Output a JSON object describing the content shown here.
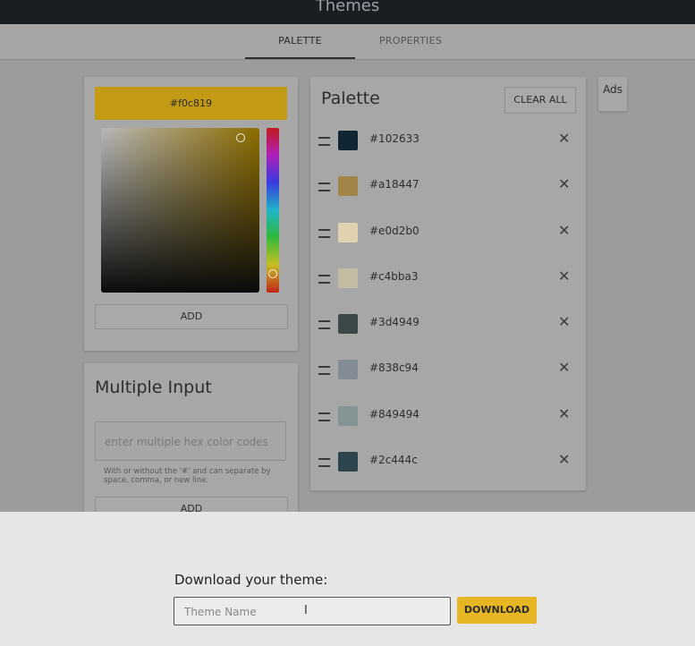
{
  "app": {
    "title": "Themes"
  },
  "tabs": [
    {
      "label": "PALETTE"
    },
    {
      "label": "PROPERTIES"
    }
  ],
  "picker": {
    "hex_display": "#f0c819",
    "add_label": "ADD"
  },
  "multiple_input": {
    "title": "Multiple Input",
    "placeholder": "enter multiple hex color codes",
    "help": "With or without the '#' and can separate by space, comma, or new line.",
    "add_label": "ADD"
  },
  "palette": {
    "title": "Palette",
    "clear_all_label": "CLEAR ALL",
    "items": [
      {
        "hex": "#102633",
        "color": "#102633"
      },
      {
        "hex": "#a18447",
        "color": "#a18447"
      },
      {
        "hex": "#e0d2b0",
        "color": "#e0d2b0"
      },
      {
        "hex": "#c4bba3",
        "color": "#c4bba3"
      },
      {
        "hex": "#3d4949",
        "color": "#3d4949"
      },
      {
        "hex": "#838c94",
        "color": "#838c94"
      },
      {
        "hex": "#849494",
        "color": "#849494"
      },
      {
        "hex": "#2c444c",
        "color": "#2c444c"
      }
    ]
  },
  "ads": {
    "label": "Ads"
  },
  "download": {
    "label": "Download your theme:",
    "placeholder": "Theme Name",
    "button_label": "DOWNLOAD"
  }
}
